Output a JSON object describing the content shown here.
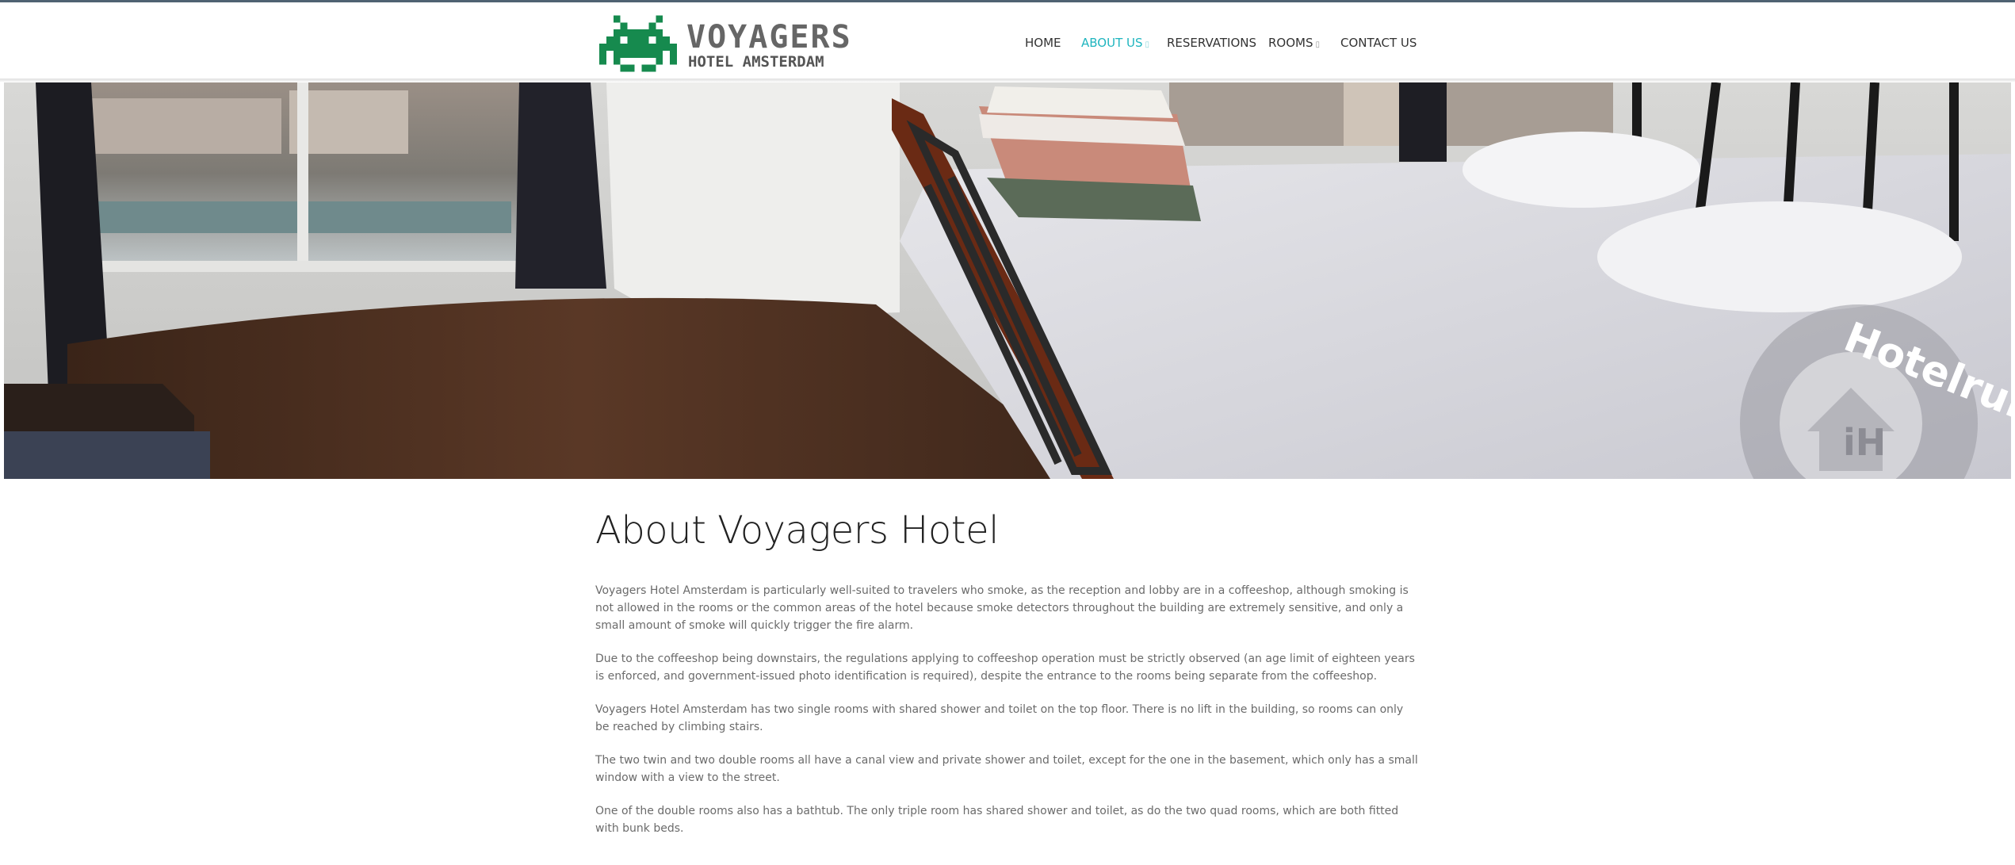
{
  "brand": {
    "title": "VOYAGERS",
    "subtitle": "HOTEL AMSTERDAM",
    "icon": "space-invader-icon",
    "icon_color": "#168a4e"
  },
  "nav": {
    "items": [
      {
        "label": "HOME",
        "active": false,
        "has_caret": false
      },
      {
        "label": "ABOUT US",
        "active": true,
        "has_caret": true
      },
      {
        "label": "RESERVATIONS",
        "active": false,
        "has_caret": false
      },
      {
        "label": "ROOMS",
        "active": false,
        "has_caret": true
      },
      {
        "label": "CONTACT US",
        "active": false,
        "has_caret": false
      }
    ],
    "caret_glyph": "▯",
    "active_color": "#1fb5bf"
  },
  "hero": {
    "watermark": "Hotelrun"
  },
  "main": {
    "title": "About Voyagers Hotel",
    "paragraphs": [
      "Voyagers Hotel Amsterdam is particularly well-suited to travelers who smoke, as the reception and lobby are in a coffeeshop, although smoking is not allowed in the rooms or the common areas of the hotel because smoke detectors throughout the building are extremely sensitive, and only a small amount of smoke will quickly trigger the fire alarm.",
      "Due to the coffeeshop being downstairs, the regulations applying to coffeeshop operation must be strictly observed (an age limit of eighteen years is enforced, and government-issued photo identification is required), despite the entrance to the rooms being separate from the coffeeshop.",
      "Voyagers Hotel Amsterdam has two single rooms with shared shower and toilet on the top floor. There is no lift in the building, so rooms can only be reached by climbing stairs.",
      "The two twin and two double rooms all have a canal view and private shower and toilet, except for the one in the basement, which only has a small window with a view to the street.",
      "One of the double rooms also has a bathtub. The only triple room has shared shower and toilet, as do the two quad rooms, which are both fitted with bunk beds."
    ]
  }
}
